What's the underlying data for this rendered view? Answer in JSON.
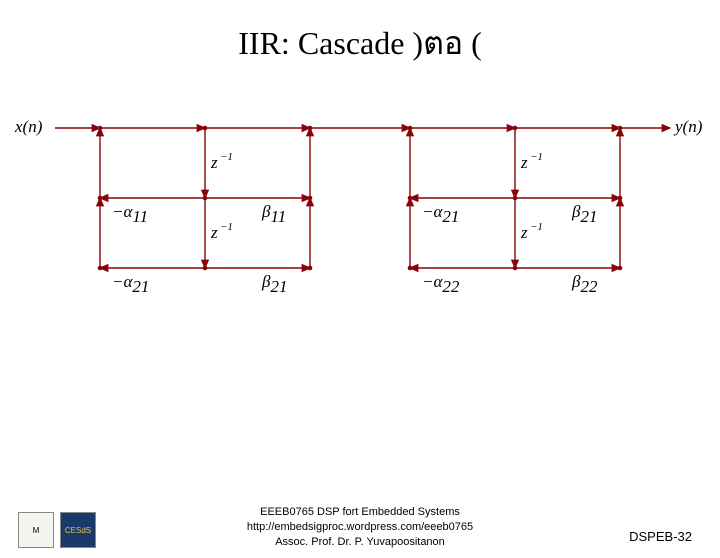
{
  "title": "IIR: Cascade )ตอ  (",
  "io": {
    "input": "x(n)",
    "output": "y(n)"
  },
  "stage1": {
    "d1": "z",
    "d1exp": "−1",
    "d2": "z",
    "d2exp": "−1",
    "a1": "−α",
    "a1sub": "11",
    "a2": "−α",
    "a2sub": "21",
    "b1": "β",
    "b1sub": "11",
    "b2": "β",
    "b2sub": "21"
  },
  "stage2": {
    "d1": "z",
    "d1exp": "−1",
    "d2": "z",
    "d2exp": "−1",
    "a1": "−α",
    "a1sub": "21",
    "a2": "−α",
    "a2sub": "22",
    "b1": "β",
    "b1sub": "21",
    "b2": "β",
    "b2sub": "22"
  },
  "footer": {
    "line1": "EEEB0765 DSP fort Embedded Systems",
    "line2": "http://embedsigproc.wordpress.com/eeeb0765",
    "line3": "Assoc. Prof. Dr. P. Yuvapoositanon"
  },
  "slide": "DSPEB-32",
  "logos": {
    "l1": "M",
    "l2": "CESdS"
  }
}
